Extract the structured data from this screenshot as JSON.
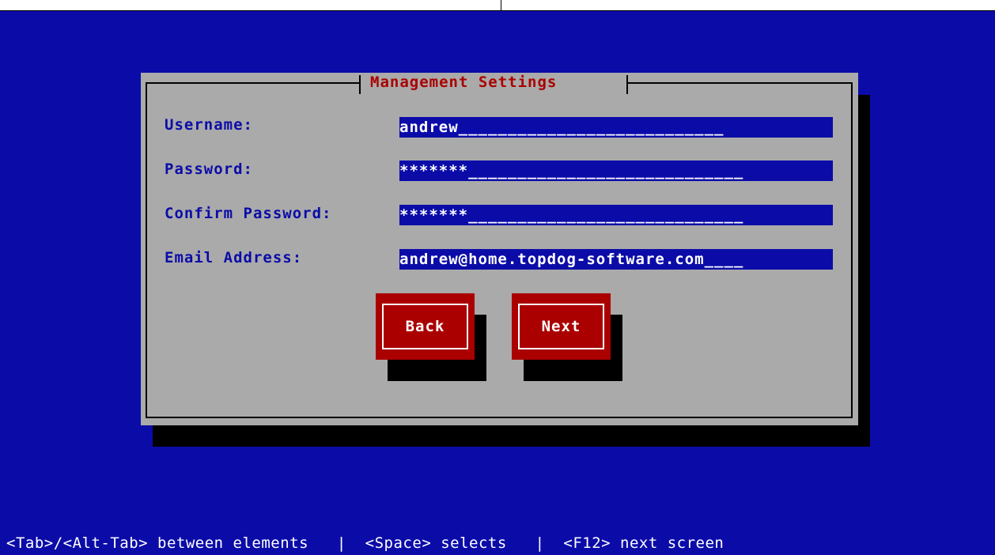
{
  "dialog": {
    "title": "Management Settings"
  },
  "fields": [
    {
      "label": "Username:",
      "value": "andrew",
      "filler": "___________________________"
    },
    {
      "label": "Password:",
      "value": "*******",
      "filler": "____________________________"
    },
    {
      "label": "Confirm Password:",
      "value": "*******",
      "filler": "____________________________"
    },
    {
      "label": "Email Address:",
      "value": "andrew@home.topdog-software.com",
      "filler": "____"
    }
  ],
  "buttons": {
    "back": "Back",
    "next": "Next"
  },
  "statusbar": {
    "text": "<Tab>/<Alt-Tab> between elements   |  <Space> selects   |  <F12> next screen"
  },
  "colors": {
    "background": "#0b0ca8",
    "dialog": "#aaaaaa",
    "accent": "#aa0000",
    "text": "#ffffff"
  }
}
